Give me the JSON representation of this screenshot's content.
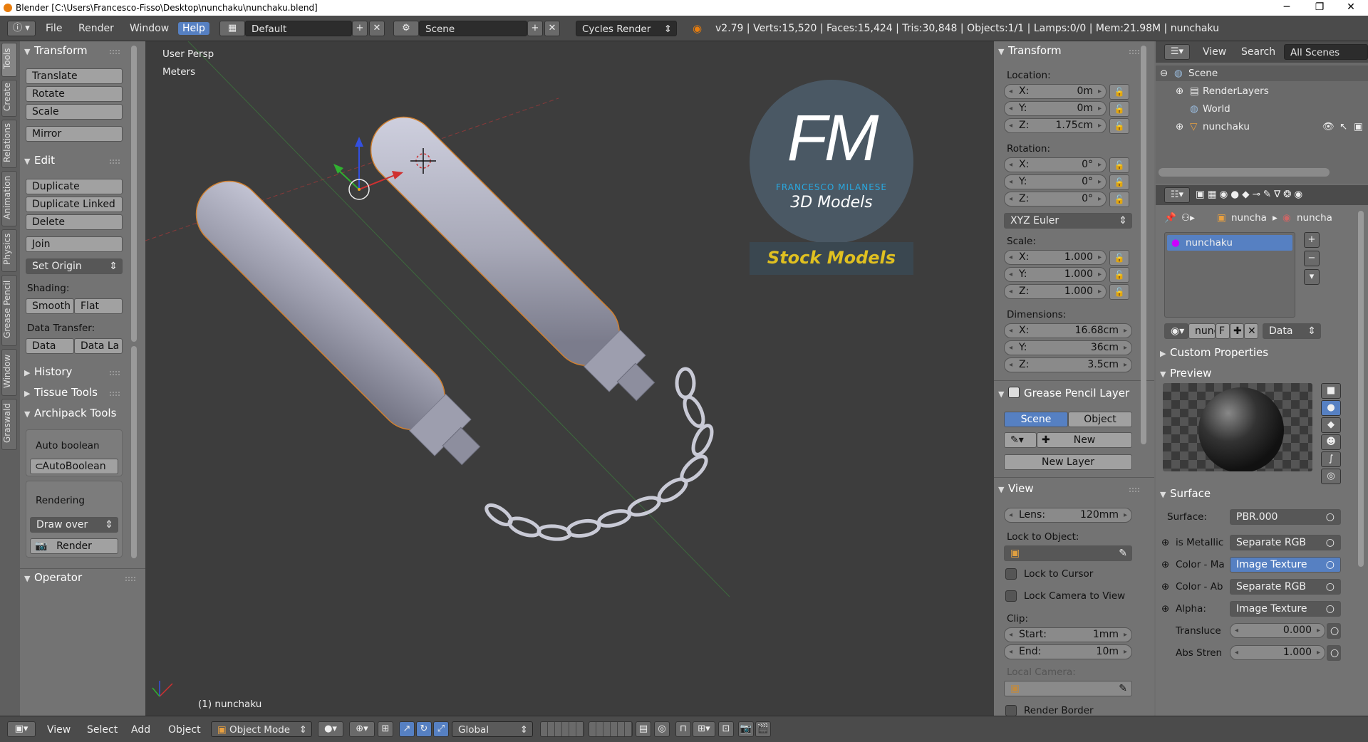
{
  "window": {
    "title": "Blender [C:\\Users\\Francesco-Fisso\\Desktop\\nunchaku\\nunchaku.blend]"
  },
  "topbar": {
    "menus": [
      "File",
      "Render",
      "Window",
      "Help"
    ],
    "layout": "Default",
    "scene": "Scene",
    "engine": "Cycles Render",
    "stats": "v2.79 | Verts:15,520 | Faces:15,424 | Tris:30,848 | Objects:1/1 | Lamps:0/0 | Mem:21.98M | nunchaku"
  },
  "left_tabs": [
    "Tools",
    "Create",
    "Relations",
    "Animation",
    "Physics",
    "Grease Pencil",
    "Window",
    "Graswald"
  ],
  "tools": {
    "transform_header": "Transform",
    "translate": "Translate",
    "rotate": "Rotate",
    "scale": "Scale",
    "mirror": "Mirror",
    "edit_header": "Edit",
    "duplicate": "Duplicate",
    "duplicate_linked": "Duplicate Linked",
    "delete": "Delete",
    "join": "Join",
    "set_origin": "Set Origin",
    "shading_label": "Shading:",
    "smooth": "Smooth",
    "flat": "Flat",
    "data_transfer_label": "Data Transfer:",
    "data": "Data",
    "data_la": "Data La",
    "history": "History",
    "tissue": "Tissue Tools",
    "archipack": "Archipack Tools",
    "auto_boolean_label": "Auto boolean",
    "auto_boolean_btn": "AutoBoolean",
    "rendering_label": "Rendering",
    "draw_over": "Draw over",
    "render": "Render",
    "operator": "Operator"
  },
  "viewport": {
    "view_name": "User Persp",
    "units": "Meters",
    "object_label": "(1) nunchaku",
    "logo_letters": "FM",
    "logo_name": "FRANCESCO MILANESE",
    "logo_sub": "3D Models",
    "stock": "Stock Models"
  },
  "npanel": {
    "transform": "Transform",
    "location": "Location:",
    "loc": [
      [
        "X:",
        "0m"
      ],
      [
        "Y:",
        "0m"
      ],
      [
        "Z:",
        "1.75cm"
      ]
    ],
    "rotation": "Rotation:",
    "rot": [
      [
        "X:",
        "0°"
      ],
      [
        "Y:",
        "0°"
      ],
      [
        "Z:",
        "0°"
      ]
    ],
    "rot_mode": "XYZ Euler",
    "scale": "Scale:",
    "scl": [
      [
        "X:",
        "1.000"
      ],
      [
        "Y:",
        "1.000"
      ],
      [
        "Z:",
        "1.000"
      ]
    ],
    "dimensions": "Dimensions:",
    "dim": [
      [
        "X:",
        "16.68cm"
      ],
      [
        "Y:",
        "36cm"
      ],
      [
        "Z:",
        "3.5cm"
      ]
    ],
    "gp_layer": "Grease Pencil Layer",
    "gp_scene": "Scene",
    "gp_object": "Object",
    "gp_new": "New",
    "gp_new_layer": "New Layer",
    "view": "View",
    "lens": [
      "Lens:",
      "120mm"
    ],
    "lock_obj": "Lock to Object:",
    "lock_cursor": "Lock to Cursor",
    "lock_cam": "Lock Camera to View",
    "clip": "Clip:",
    "clip_start": [
      "Start:",
      "1mm"
    ],
    "clip_end": [
      "End:",
      "10m"
    ],
    "local_cam": "Local Camera:",
    "render_border": "Render Border"
  },
  "outliner": {
    "view": "View",
    "search": "Search",
    "filter": "All Scenes",
    "items": [
      "Scene",
      "RenderLayers",
      "World",
      "nunchaku"
    ]
  },
  "props": {
    "crumb1": "nuncha",
    "crumb2": "nuncha",
    "material": "nunchaku",
    "mat_short": "nunc",
    "mat_f": "F",
    "data_dd": "Data",
    "custom": "Custom Properties",
    "preview": "Preview",
    "surface_header": "Surface",
    "surface_label": "Surface:",
    "surface_val": "PBR.000",
    "rows": [
      [
        "is Metallic",
        "Separate RGB"
      ],
      [
        "Color - Ma",
        "Image Texture"
      ],
      [
        "Color - Ab",
        "Separate RGB"
      ],
      [
        "Alpha:",
        "Image Texture"
      ]
    ],
    "transluce": [
      "Transluce",
      "0.000"
    ],
    "abs": [
      "Abs Stren",
      "1.000"
    ]
  },
  "bottombar": {
    "menus": [
      "View",
      "Select",
      "Add",
      "Object"
    ],
    "mode": "Object Mode",
    "orientation": "Global"
  }
}
